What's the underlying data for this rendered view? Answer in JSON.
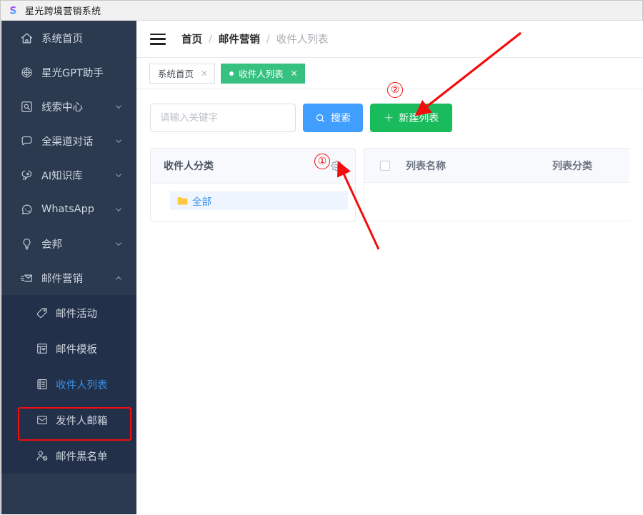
{
  "window": {
    "title": "星光跨境营销系统",
    "logo_icon": "logo-s-icon"
  },
  "sidebar": {
    "bg_color": "#2b3a4f",
    "submenu_bg_color": "#22304a",
    "items": [
      {
        "label": "系统首页",
        "icon": "home-icon",
        "has_chevron": false
      },
      {
        "label": "星光GPT助手",
        "icon": "gpt-icon",
        "has_chevron": false
      },
      {
        "label": "线索中心",
        "icon": "clue-icon",
        "has_chevron": true,
        "chevron": "down"
      },
      {
        "label": "全渠道对话",
        "icon": "chat-icon",
        "has_chevron": true,
        "chevron": "down"
      },
      {
        "label": "AI知识库",
        "icon": "ai-brain-icon",
        "has_chevron": true,
        "chevron": "down"
      },
      {
        "label": "WhatsApp",
        "icon": "whatsapp-icon",
        "has_chevron": true,
        "chevron": "down"
      },
      {
        "label": "会邦",
        "icon": "bulb-icon",
        "has_chevron": true,
        "chevron": "down"
      },
      {
        "label": "邮件营销",
        "icon": "mail-send-icon",
        "has_chevron": true,
        "chevron": "up"
      }
    ],
    "submenu": [
      {
        "label": "邮件活动",
        "icon": "tag-icon",
        "active": false
      },
      {
        "label": "邮件模板",
        "icon": "template-icon",
        "active": false
      },
      {
        "label": "收件人列表",
        "icon": "list-icon",
        "active": true
      },
      {
        "label": "发件人邮箱",
        "icon": "envelope-icon",
        "active": false
      },
      {
        "label": "邮件黑名单",
        "icon": "user-block-icon",
        "active": false
      }
    ],
    "active_highlight_color": "#f40d0d",
    "active_label_color": "#3b8fe8"
  },
  "topbar": {
    "menu_icon": "hamburger-icon",
    "breadcrumb": [
      {
        "label": "首页",
        "current": false
      },
      {
        "label": "邮件营销",
        "current": false
      },
      {
        "label": "收件人列表",
        "current": true
      }
    ],
    "separator": "/"
  },
  "tabs": [
    {
      "label": "系统首页",
      "selected": false,
      "close_icon": "close-icon"
    },
    {
      "label": "收件人列表",
      "selected": true,
      "close_icon": "close-icon"
    }
  ],
  "toolbar": {
    "search_placeholder": "请输入关键字",
    "search_value": "",
    "search_button_label": "搜索",
    "search_button_icon": "search-icon",
    "search_button_color": "#409eff",
    "new_button_label": "新建列表",
    "new_button_icon": "plus-icon",
    "new_button_color": "#19bb5d"
  },
  "category_panel": {
    "title": "收件人分类",
    "settings_icon": "gear-icon",
    "tree": [
      {
        "label": "全部",
        "icon": "folder-icon",
        "selected": true
      }
    ]
  },
  "table": {
    "select_all_icon": "checkbox-icon",
    "columns": [
      {
        "label": "列表名称"
      },
      {
        "label": "列表分类"
      }
    ],
    "rows": []
  },
  "annotations": {
    "color": "#f40d0d",
    "markers": [
      {
        "label": "①",
        "target": "gear-icon"
      },
      {
        "label": "②",
        "target": "new-list-button"
      }
    ]
  }
}
